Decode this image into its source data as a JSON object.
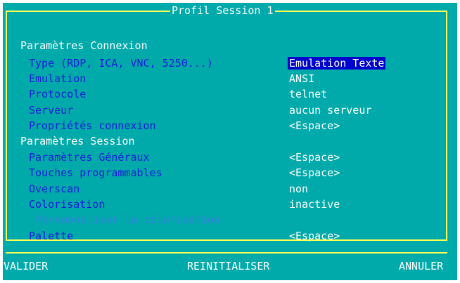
{
  "window": {
    "title": "Profil Session 1"
  },
  "sections": {
    "connexion": "Paramètres Connexion",
    "session": "Paramètres Session"
  },
  "rows": [
    {
      "label": "Type (RDP, ICA, VNC, 5250...)",
      "value": "Emulation Texte"
    },
    {
      "label": "Emulation",
      "value": "ANSI"
    },
    {
      "label": "Protocole",
      "value": "telnet"
    },
    {
      "label": "Serveur",
      "value": "aucun serveur"
    },
    {
      "label": "Propriétés connexion",
      "value": "<Espace>"
    },
    {
      "label": "Paramètres Généraux",
      "value": "<Espace>"
    },
    {
      "label": "Touches programmables",
      "value": "<Espace>"
    },
    {
      "label": "Overscan",
      "value": "non"
    },
    {
      "label": "Colorisation",
      "value": "inactive"
    },
    {
      "label": "Personnaliser la colorisation",
      "value": ""
    },
    {
      "label": "Palette",
      "value": "<Espace>"
    }
  ],
  "buttons": {
    "valider": "VALIDER",
    "reinitialiser": "REINITIALISER",
    "annuler": "ANNULER"
  },
  "colors": {
    "background": "#00aaaa",
    "border": "#ffff55",
    "label": "#1b1bd9",
    "disabled": "#3a7fe6",
    "highlight": "#0000cc"
  }
}
